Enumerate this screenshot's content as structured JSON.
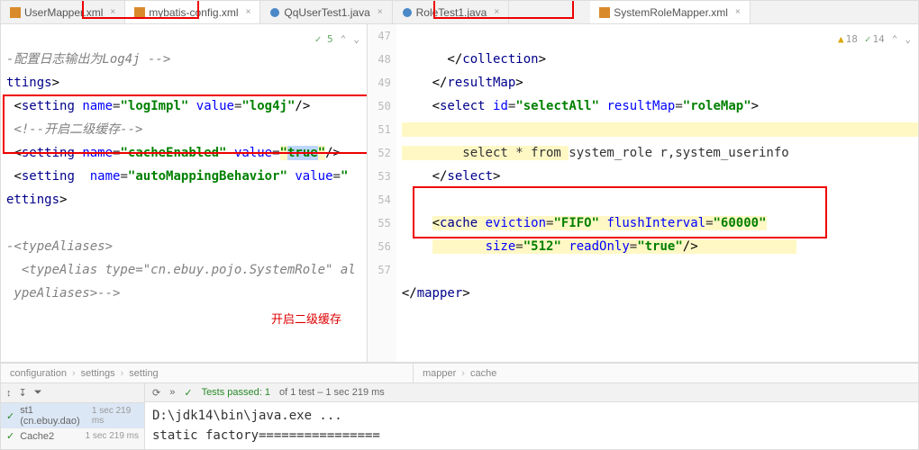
{
  "tabs": [
    {
      "label": "UserMapper.xml",
      "active": false
    },
    {
      "label": "mybatis-config.xml",
      "active": true
    },
    {
      "label": "QqUserTest1.java",
      "active": false
    },
    {
      "label": "RoleTest1.java",
      "active": false
    },
    {
      "label": "SystemRoleMapper.xml",
      "active": true
    }
  ],
  "left": {
    "hint1": "5",
    "lines": [
      "-配置日志输出为Log4j -->",
      "ttings>",
      " <setting name=\"logImpl\" value=\"log4j\"/>",
      " <!--开启二级缓存-->",
      " <setting name=\"cacheEnabled\" value=\"true\"/>",
      " <setting  name=\"autoMappingBehavior\" value=\"",
      "ettings>",
      "",
      "-<typeAliases>",
      "  <typeAlias type=\"cn.ebuy.pojo.SystemRole\" al",
      " ypeAliases>-->",
      "",
      "",
      ""
    ],
    "breadcrumbs": [
      "configuration",
      "settings",
      "setting"
    ],
    "annotation": "开启二级缓存"
  },
  "right": {
    "warnA": "18",
    "warnB": "14",
    "startLine": 47,
    "lines": [
      "    </collection>",
      "  </resultMap>",
      "  <select id=\"selectAll\" resultMap=\"roleMap\">",
      "",
      "      select * from system_role r,system_userinfo",
      "  </select>",
      "",
      "  <cache eviction=\"FIFO\" flushInterval=\"60000\"",
      "         size=\"512\" readOnly=\"true\"/>",
      "",
      "</mapper>",
      "",
      ""
    ],
    "breadcrumbs": [
      "mapper",
      "cache"
    ]
  },
  "run": {
    "row1": {
      "name": "st1 (cn.ebuy.dao)",
      "time": "1 sec 219 ms"
    },
    "row2": {
      "name": "Cache2",
      "time": "1 sec 219 ms"
    },
    "passed": "Tests passed: 1",
    "passedTail": " of 1 test – 1 sec 219 ms",
    "console1": "D:\\jdk14\\bin\\java.exe ...",
    "console2": "static factory================"
  }
}
